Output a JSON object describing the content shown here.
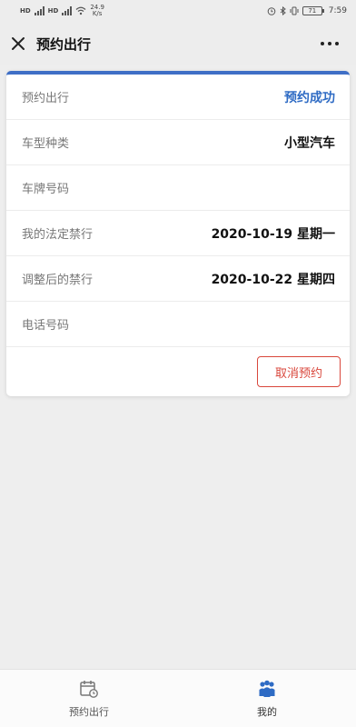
{
  "status_bar": {
    "network_left": "HD",
    "network_right": "HD",
    "speed_value": "24.9",
    "speed_unit": "K/s",
    "battery": "71",
    "time": "7:59"
  },
  "nav": {
    "title": "预约出行"
  },
  "details": [
    {
      "label": "预约出行",
      "value": "预约成功",
      "accent": true
    },
    {
      "label": "车型种类",
      "value": "小型汽车"
    },
    {
      "label": "车牌号码",
      "value": ""
    },
    {
      "label": "我的法定禁行",
      "value": "2020-10-19 星期一"
    },
    {
      "label": "调整后的禁行",
      "value": "2020-10-22 星期四"
    },
    {
      "label": "电话号码",
      "value": ""
    }
  ],
  "cancel_label": "取消预约",
  "tabs": [
    {
      "label": "预约出行",
      "icon": "calendar-icon"
    },
    {
      "label": "我的",
      "icon": "people-icon"
    }
  ],
  "colors": {
    "accent": "#3f6fc6",
    "danger": "#d9473c",
    "tab_active": "#2e6bc4"
  }
}
